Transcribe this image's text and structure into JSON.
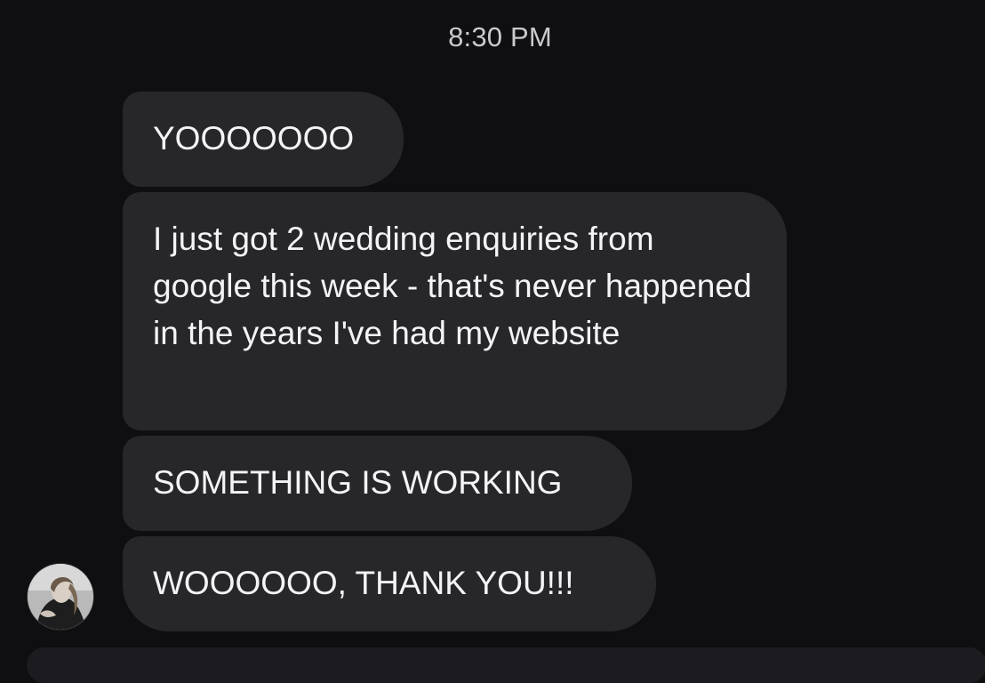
{
  "header": {
    "timestamp": "8:30 PM"
  },
  "messages": [
    {
      "text": "YOOOOOOO"
    },
    {
      "text": "I just got 2 wedding enquiries from google this week - that's never happened in the years I've had my website"
    },
    {
      "text": "SOMETHING IS WORKING"
    },
    {
      "text": "WOOOOOO, THANK YOU!!!"
    }
  ],
  "sender": {
    "avatar_icon": "user-avatar-photo"
  },
  "colors": {
    "background": "#0f0f12",
    "bubble": "#27272a",
    "text": "#f4f4f6",
    "timestamp": "#c9c9ce"
  }
}
